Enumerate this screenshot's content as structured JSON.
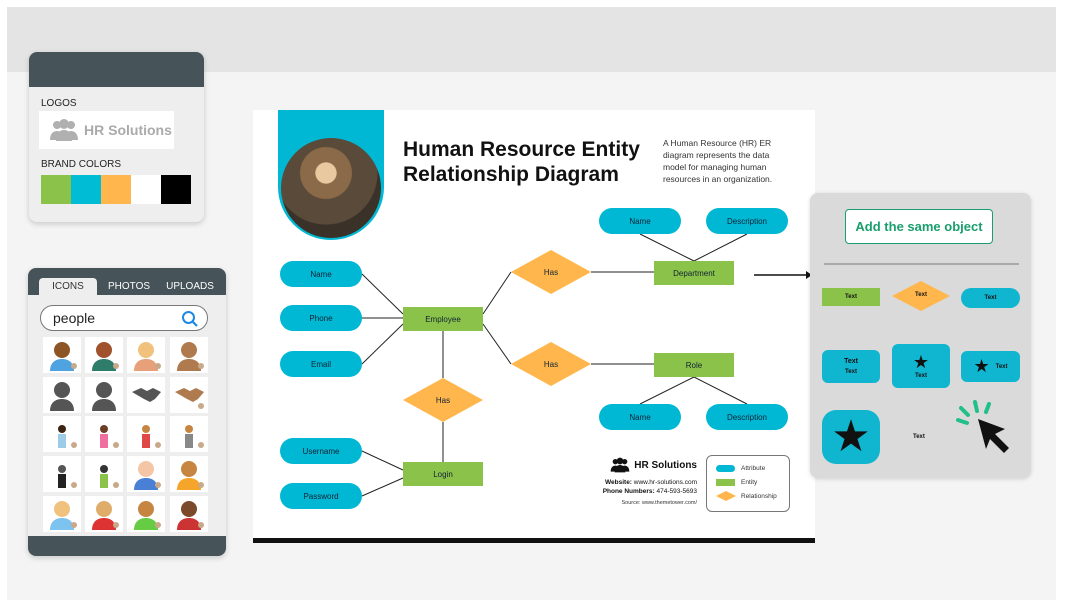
{
  "brand_panel": {
    "logos_label": "LOGOS",
    "logo_text": "HR Solutions",
    "brand_colors_label": "BRAND COLORS",
    "colors": [
      "#8bc34a",
      "#00bcd4",
      "#ffb74d",
      "#ffffff",
      "#000000"
    ]
  },
  "asset_panel": {
    "tabs": [
      {
        "label": "ICONS",
        "active": true
      },
      {
        "label": "PHOTOS"
      },
      {
        "label": "UPLOADS"
      }
    ],
    "search_value": "people",
    "search_icon": "search-icon",
    "icons": [
      "man-icon",
      "family-icon",
      "red-hair-woman-icon",
      "man-face-icon",
      "person-silhouette-icon",
      "woman-silhouette-icon",
      "handshake-icon",
      "handshake-skin-icon",
      "woman-standing-icon",
      "girl-icon",
      "boy-waving-icon",
      "turban-man-icon",
      "hijab-woman-icon",
      "wheelchair-woman-icon",
      "pink-hair-woman-icon",
      "woman-face-icon",
      "glasses-man-icon",
      "woman-brown-hair-icon",
      "bald-old-man-icon",
      "bearded-man-icon"
    ]
  },
  "diagram": {
    "title_line1": "Human Resource Entity",
    "title_line2": "Relationship Diagram",
    "description": "A Human Resource (HR) ER diagram represents the data model for managing human resources in an organization.",
    "attributes": {
      "emp_name": "Name",
      "phone": "Phone",
      "email": "Email",
      "username": "Username",
      "password": "Password",
      "dept_name": "Name",
      "dept_desc": "Description",
      "role_name": "Name",
      "role_desc": "Description"
    },
    "entities": {
      "employee": "Employee",
      "department": "Department",
      "role": "Role",
      "login": "Login"
    },
    "relationships": {
      "has_dept": "Has",
      "has_role": "Has",
      "has_login": "Has"
    },
    "footer": {
      "company": "HR Solutions",
      "website_label": "Website:",
      "website": "www.hr-solutions.com",
      "phone_label": "Phone Numbers:",
      "phone": "474-593-5693",
      "source": "Source: www.themetower.com/"
    },
    "legend": {
      "attribute": "Attribute",
      "entity": "Entity",
      "relationship": "Relationship"
    },
    "colors": {
      "attribute": "#00b8d4",
      "entity": "#8bc34a",
      "relationship": "#ffb74d"
    }
  },
  "object_panel": {
    "button": "Add the same object",
    "sample_text": "Text",
    "button_color": "#1a9e6e"
  }
}
